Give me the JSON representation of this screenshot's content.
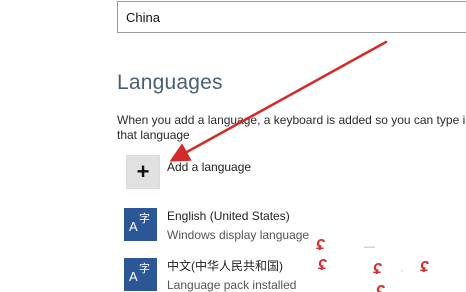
{
  "region": {
    "country_value": "China"
  },
  "languages": {
    "title": "Languages",
    "description": "When you add a language, a keyboard is added so you can type in that language",
    "add_label": "Add a language",
    "add_icon": "plus-icon",
    "items": [
      {
        "name": "English (United States)",
        "status": "Windows display language",
        "icon_letter": "A",
        "icon_char": "字",
        "icon_color": "#2b5797"
      },
      {
        "name": "中文(中华人民共和国)",
        "status": "Language pack installed",
        "icon_letter": "A",
        "icon_char": "字",
        "icon_color": "#2b5797"
      }
    ]
  },
  "annotation": {
    "arrow_color": "#d32a2a",
    "watermark_color": "#d33131"
  }
}
